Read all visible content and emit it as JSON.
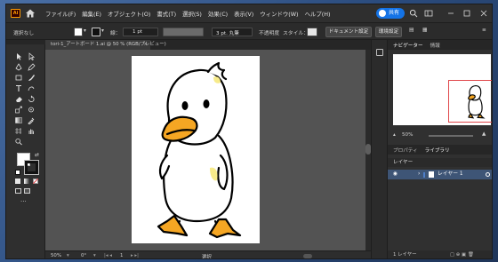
{
  "app": {
    "logo_text": "Ai",
    "share_label": "共有"
  },
  "menu": [
    "ファイル(F)",
    "編集(E)",
    "オブジェクト(O)",
    "書式(T)",
    "選択(S)",
    "効果(C)",
    "表示(V)",
    "ウィンドウ(W)",
    "ヘルプ(H)"
  ],
  "control_bar": {
    "selection": "選択なし",
    "stroke_label": "線：",
    "stroke_value": "1 pt",
    "profile": "3 pt. 丸筆",
    "opacity_label": "不透明度",
    "style_label": "スタイル：",
    "doc_settings": "ドキュメント設定",
    "prefs": "環境設定"
  },
  "document": {
    "tab_label": "tori-1_アートボード 1.ai @ 50 % (RGB/プレビュー)",
    "zoom": "50%",
    "rotation": "0°",
    "page": "1",
    "tool_status": "選択"
  },
  "panels": {
    "navigator_tab": "ナビゲーター",
    "info_tab": "情報",
    "nav_zoom": "50%",
    "props_tab": "プロパティ",
    "libraries_tab": "ライブラリ",
    "layers_tab": "レイヤー",
    "layer_name": "レイヤー 1",
    "layers_count": "1 レイヤー"
  },
  "colors": {
    "accent": "#1473e6",
    "artboard_nav_frame": "#e0464a",
    "duck_beak": "#f5a623",
    "layer_color": "#4f7fc9"
  }
}
